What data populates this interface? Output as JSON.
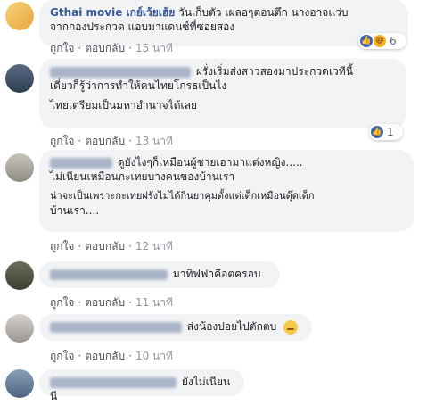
{
  "labels": {
    "like": "ถูกใจ",
    "reply": "ตอบกลับ",
    "sep": "·"
  },
  "comments": [
    {
      "author": "Gthai movie เกย์เว้ยเฮ้ย",
      "lines": [
        "วันเก็บตัว เผลอๆตอนตึก นางอาจแว่บ",
        "จากกองประกวด แอบมาแดนซ์ที่ซอยสอง"
      ],
      "time": "15 นาที",
      "reactions": {
        "icons": [
          "like-icon",
          "haha-icon"
        ],
        "count": "6"
      }
    },
    {
      "author": "",
      "lines": [
        "ฝรั่งเริ่มส่งสาวสองมาประกวดเวทีนี้",
        "เดี๋ยวก็รู้ว่าการทำให้คนไทยโกรธเป็นไง",
        "",
        "ไทยเตรียมเป็นมหาอำนาจได้เลย"
      ],
      "time": "13 นาที",
      "reactions": {
        "icons": [
          "like-icon"
        ],
        "count": "1"
      }
    },
    {
      "author": "",
      "lines": [
        "ดูยังไงๆก็เหมือนผู้ชายเอามาแต่งหญิง.....",
        "ไม่เนียนเหมือนกะเทยบางคนของบ้านเรา",
        "",
        "น่าจะเป็นเพราะกะเทยฝรั่งไม่ได้กินยาคุมตั้งแต่เด็กเหมือนตุ๊ดเด็ก",
        "บ้านเรา...."
      ],
      "time": "12 นาที"
    },
    {
      "author": "",
      "lines": [
        "มาทิฟฟาคือตครอบ"
      ],
      "time": "11 นาที"
    },
    {
      "author": "",
      "lines": [
        "ส่งน้องปอยไปตักตบ"
      ],
      "time": "10 นาที",
      "emoji": "sad-face-emoji"
    },
    {
      "author": "",
      "lines": [
        "ยังไม่เนียนนี"
      ],
      "time": ""
    }
  ],
  "colors": {
    "author": "#385898",
    "bubble": "#f2f3f5",
    "like": "#4267b2",
    "haha": "#f7b125"
  }
}
